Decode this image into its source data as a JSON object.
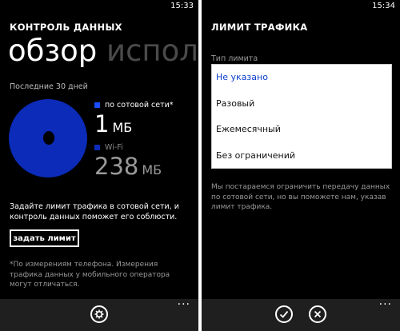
{
  "colors": {
    "accent": "#0b2bb8",
    "background": "#000000",
    "app_bar": "#1f1f1f"
  },
  "left": {
    "status_time": "15:33",
    "app_title": "КОНТРОЛЬ ДАННЫХ",
    "pivot_active": "обзор",
    "pivot_next": "использ",
    "period": "Последние 30 дней",
    "chart_data": {
      "type": "pie",
      "title": "",
      "slices": [
        {
          "name": "по сотовой сети*",
          "value": 1,
          "unit": "МБ"
        },
        {
          "name": "Wi-Fi",
          "value": 238,
          "unit": "МБ"
        }
      ]
    },
    "cellular": {
      "label": "по сотовой сети*",
      "value": "1",
      "unit": "МБ"
    },
    "wifi": {
      "label": "Wi-Fi",
      "value": "238",
      "unit": "МБ"
    },
    "hint": "Задайте лимит трафика в сотовой сети, и контроль данных поможет его соблюсти.",
    "set_limit_label": "задать лимит",
    "footnote": "*По измерениям телефона. Измерения трафика данных у мобильного оператора могут отличаться.",
    "app_bar": {
      "settings_icon": "gear-icon",
      "more": "···"
    }
  },
  "right": {
    "status_time": "15:34",
    "app_title": "ЛИМИТ ТРАФИКА",
    "section_label": "Тип лимита",
    "options": [
      {
        "label": "Не указано",
        "selected": true
      },
      {
        "label": "Разовый",
        "selected": false
      },
      {
        "label": "Ежемесячный",
        "selected": false
      },
      {
        "label": "Без ограничений",
        "selected": false
      }
    ],
    "note": "Мы постараемся ограничить передачу данных по сотовой сети, но вы поможете нам, указав лимит трафика.",
    "app_bar": {
      "confirm_icon": "check-icon",
      "cancel_icon": "close-icon",
      "more": "···"
    }
  }
}
